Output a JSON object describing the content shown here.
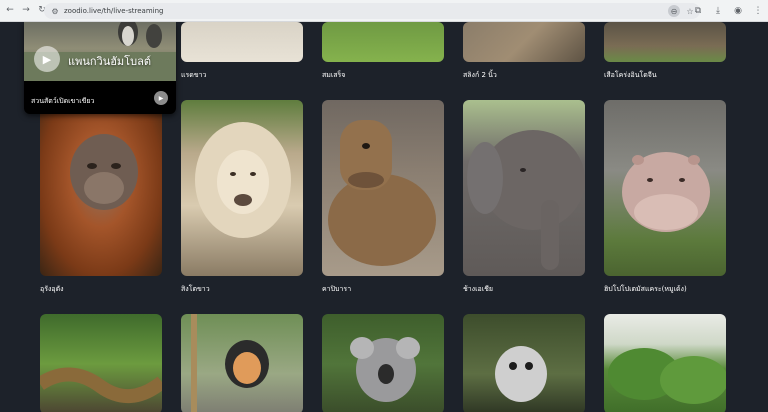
{
  "browser": {
    "url": "zoodio.live/th/live-streaming",
    "nav": {
      "back": "←",
      "forward": "→",
      "reload": "↻"
    },
    "omnibox_right": {
      "zoom": "⊖",
      "star": "☆"
    },
    "toolbar_right": {
      "extensions": "⧉",
      "download": "⤓",
      "profile": "◉",
      "menu": "⋮"
    }
  },
  "pip": {
    "overlay_title": "แพนกวินฮัมโบลต์",
    "caption": "สวนสัตว์เปิดเขาเขียว",
    "play": "▶",
    "play_small": "▶"
  },
  "top_row": [
    {
      "label": ""
    },
    {
      "label": "แรดขาว"
    },
    {
      "label": "สมเสร็จ"
    },
    {
      "label": "สลิงก์ 2 นิ้ว"
    },
    {
      "label": "เสือโคร่งอินโดจีน"
    }
  ],
  "middle_row": [
    {
      "label": "อุรังอุตัง"
    },
    {
      "label": "สิงโตขาว"
    },
    {
      "label": "คาปิบารา"
    },
    {
      "label": "ช้างเอเชีย"
    },
    {
      "label": "ฮิปโปโปเตมัสแคระ(หมูเด้ง)"
    }
  ],
  "bottom_row": [
    {
      "label": ""
    },
    {
      "label": ""
    },
    {
      "label": ""
    },
    {
      "label": ""
    },
    {
      "label": ""
    }
  ]
}
